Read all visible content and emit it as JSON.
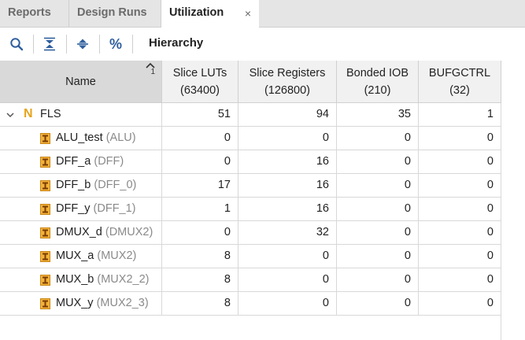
{
  "tabs": [
    {
      "label": "Reports",
      "active": false
    },
    {
      "label": "Design Runs",
      "active": false
    },
    {
      "label": "Utilization",
      "active": true
    }
  ],
  "tab_close_glyph": "×",
  "toolbar": {
    "buttons": [
      {
        "icon": "search-icon"
      },
      {
        "icon": "collapse-all-icon"
      },
      {
        "icon": "expand-all-icon"
      },
      {
        "icon": "percent-icon",
        "glyph": "%"
      }
    ],
    "view_label": "Hierarchy"
  },
  "table": {
    "columns": [
      {
        "title": "Name",
        "subtitle": ""
      },
      {
        "title": "Slice LUTs",
        "subtitle": "(63400)"
      },
      {
        "title": "Slice Registers",
        "subtitle": "(126800)"
      },
      {
        "title": "Bonded IOB",
        "subtitle": "(210)"
      },
      {
        "title": "BUFGCTRL",
        "subtitle": "(32)"
      }
    ],
    "sort_index": "1",
    "root": {
      "name": "FLS",
      "icon_glyph": "N",
      "values": [
        "51",
        "94",
        "35",
        "1"
      ]
    },
    "rows": [
      {
        "name": "ALU_test",
        "type": "(ALU)",
        "values": [
          "0",
          "0",
          "0",
          "0"
        ]
      },
      {
        "name": "DFF_a",
        "type": "(DFF)",
        "values": [
          "0",
          "16",
          "0",
          "0"
        ]
      },
      {
        "name": "DFF_b",
        "type": "(DFF_0)",
        "values": [
          "17",
          "16",
          "0",
          "0"
        ]
      },
      {
        "name": "DFF_y",
        "type": "(DFF_1)",
        "values": [
          "1",
          "16",
          "0",
          "0"
        ]
      },
      {
        "name": "DMUX_d",
        "type": "(DMUX2)",
        "values": [
          "0",
          "32",
          "0",
          "0"
        ]
      },
      {
        "name": "MUX_a",
        "type": "(MUX2)",
        "values": [
          "8",
          "0",
          "0",
          "0"
        ]
      },
      {
        "name": "MUX_b",
        "type": "(MUX2_2)",
        "values": [
          "8",
          "0",
          "0",
          "0"
        ]
      },
      {
        "name": "MUX_y",
        "type": "(MUX2_3)",
        "values": [
          "8",
          "0",
          "0",
          "0"
        ]
      }
    ]
  },
  "colors": {
    "accent": "#2f5f9e",
    "module_type": "#8a8a8a",
    "icon_orange": "#e6a41a",
    "header_bg": "#f1f1f1"
  }
}
